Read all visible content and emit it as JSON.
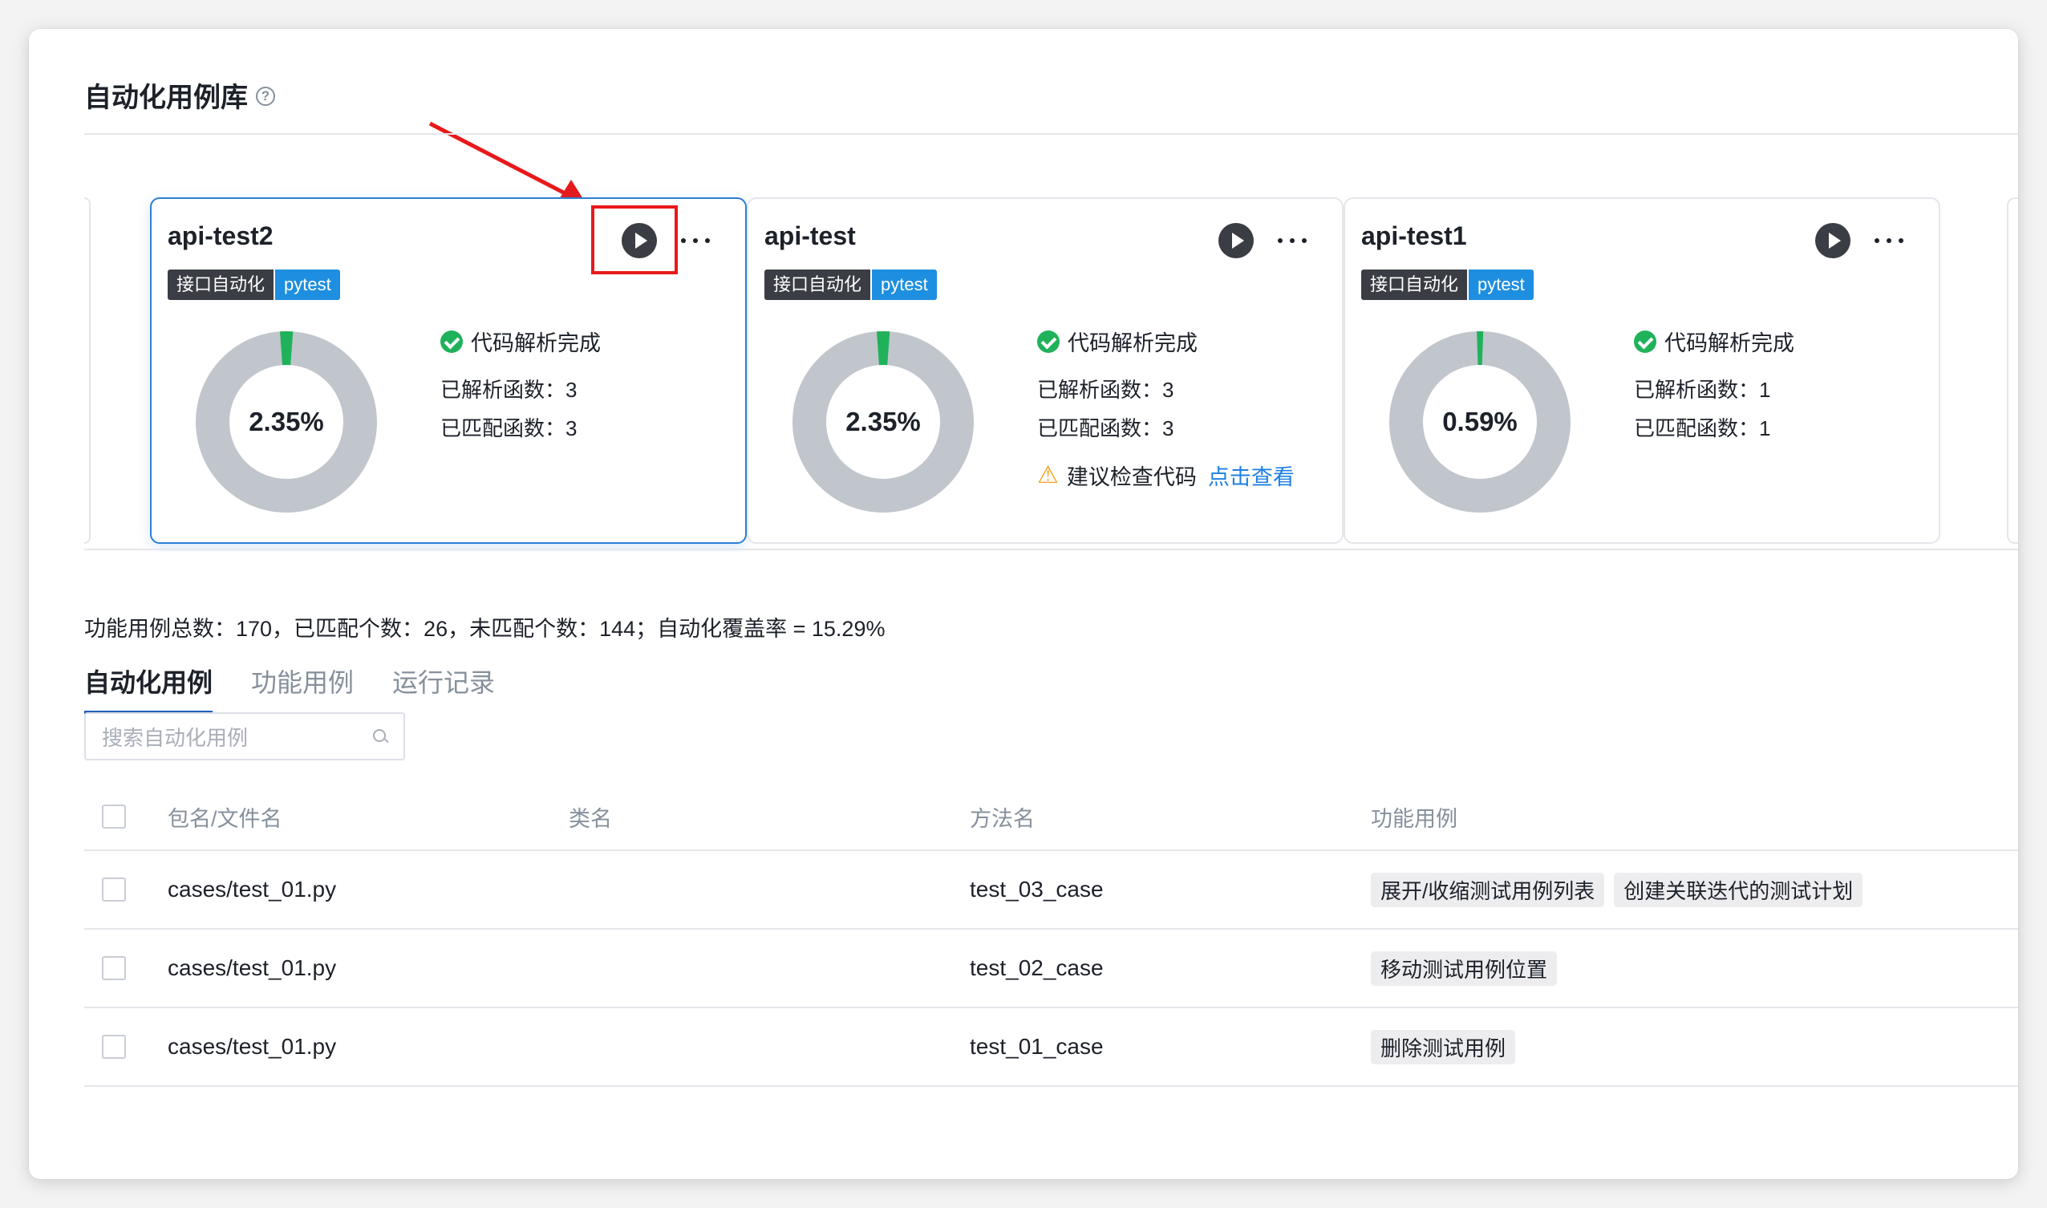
{
  "page": {
    "title": "自动化用例库",
    "help_icon": "question-circle-icon"
  },
  "cards": [
    {
      "name": "api-test2",
      "tag_type": "接口自动化",
      "tag_framework": "pytest",
      "percent_text": "2.35%",
      "percent": 2.35,
      "status": "代码解析完成",
      "parsed": "已解析函数：3",
      "matched": "已匹配函数：3",
      "selected": true
    },
    {
      "name": "api-test",
      "tag_type": "接口自动化",
      "tag_framework": "pytest",
      "percent_text": "2.35%",
      "percent": 2.35,
      "status": "代码解析完成",
      "parsed": "已解析函数：3",
      "matched": "已匹配函数：3",
      "warning": "建议检查代码",
      "warning_link": "点击查看"
    },
    {
      "name": "api-test1",
      "tag_type": "接口自动化",
      "tag_framework": "pytest",
      "percent_text": "0.59%",
      "percent": 0.59,
      "status": "代码解析完成",
      "parsed": "已解析函数：1",
      "matched": "已匹配函数：1"
    }
  ],
  "summary": "功能用例总数：170，已匹配个数：26，未匹配个数：144；自动化覆盖率 = 15.29%",
  "tabs": [
    {
      "label": "自动化用例",
      "active": true
    },
    {
      "label": "功能用例"
    },
    {
      "label": "运行记录"
    }
  ],
  "search": {
    "placeholder": "搜索自动化用例"
  },
  "table": {
    "headers": [
      "包名/文件名",
      "类名",
      "方法名",
      "功能用例"
    ],
    "rows": [
      {
        "file": "cases/test_01.py",
        "class": "",
        "method": "test_03_case",
        "features": [
          "展开/收缩测试用例列表",
          "创建关联迭代的测试计划"
        ]
      },
      {
        "file": "cases/test_01.py",
        "class": "",
        "method": "test_02_case",
        "features": [
          "移动测试用例位置"
        ]
      },
      {
        "file": "cases/test_01.py",
        "class": "",
        "method": "test_01_case",
        "features": [
          "删除测试用例"
        ]
      }
    ]
  },
  "colors": {
    "accent": "#1e8fe0",
    "success": "#20b25a",
    "donut_track": "#c1c6cd",
    "highlight": "#e8191a",
    "warning": "#f7a21b"
  }
}
